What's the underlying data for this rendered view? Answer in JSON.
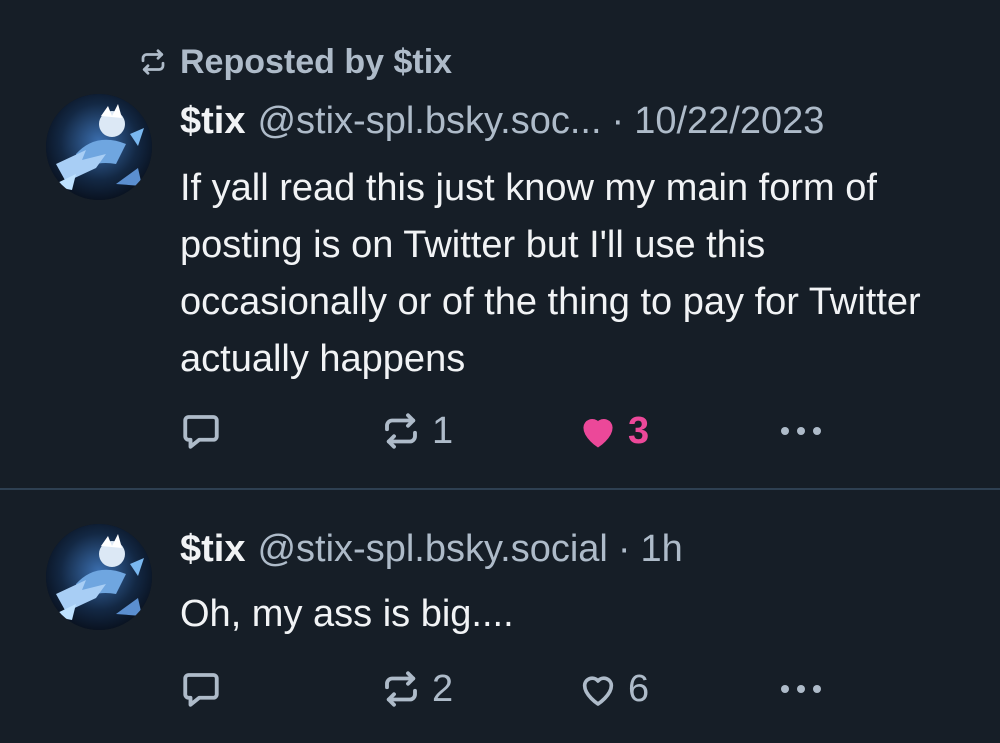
{
  "reposted_by": "Reposted by $tix",
  "posts": [
    {
      "display_name": "$tix",
      "handle": "@stix-spl.bsky.soc...",
      "separator": "·",
      "timestamp": "10/22/2023",
      "text": "If yall read this just know my main form of posting is on Twitter but I'll use this occasionally or of the thing to pay for Twitter actually happens",
      "repost_count": "1",
      "like_count": "3",
      "liked": true
    },
    {
      "display_name": "$tix",
      "handle": "@stix-spl.bsky.social",
      "separator": "·",
      "timestamp": "1h",
      "text": "Oh, my ass is big....",
      "repost_count": "2",
      "like_count": "6",
      "liked": false
    }
  ],
  "colors": {
    "background": "#161e27",
    "text": "#f1f3f5",
    "muted": "#aebbc9",
    "like_active": "#ec4899",
    "divider": "#2e4052"
  },
  "icons": {
    "repost": "repost-icon",
    "reply": "reply-icon",
    "like": "heart-icon",
    "more": "more-icon",
    "avatar": "avatar"
  }
}
